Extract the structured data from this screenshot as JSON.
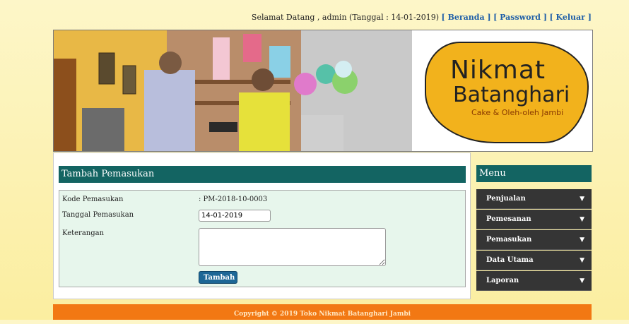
{
  "header": {
    "greeting": "Selamat Datang , admin (Tanggal : 14-01-2019)",
    "links": [
      "[ Beranda ]",
      "[ Password ]",
      "[ Keluar ]"
    ]
  },
  "banner": {
    "logo_line1": "Nikmat",
    "logo_line2": "Batanghari",
    "logo_tagline": "Cake & Oleh-oleh Jambi",
    "accent_color": "#f2b21c"
  },
  "form": {
    "title": "Tambah Pemasukan",
    "fields": {
      "kode_label": "Kode Pemasukan",
      "kode_value": ": PM-2018-10-0003",
      "tanggal_label": "Tanggal Pemasukan",
      "tanggal_value": "14-01-2019",
      "keterangan_label": "Keterangan",
      "keterangan_value": ""
    },
    "submit_label": "Tambah"
  },
  "sidebar": {
    "title": "Menu",
    "items": [
      {
        "label": "Penjualan",
        "icon": "chevron-down-icon"
      },
      {
        "label": "Pemesanan",
        "icon": "chevron-down-icon"
      },
      {
        "label": "Pemasukan",
        "icon": "chevron-down-icon"
      },
      {
        "label": "Data Utama",
        "icon": "chevron-down-icon"
      },
      {
        "label": "Laporan",
        "icon": "chevron-down-icon"
      }
    ]
  },
  "footer": {
    "text": "Copyright © 2019 Toko Nikmat Batanghari Jambi"
  },
  "colors": {
    "panel_header": "#136462",
    "menu_bg": "#353535",
    "footer_bg": "#f27813",
    "button": "#1d6796"
  }
}
